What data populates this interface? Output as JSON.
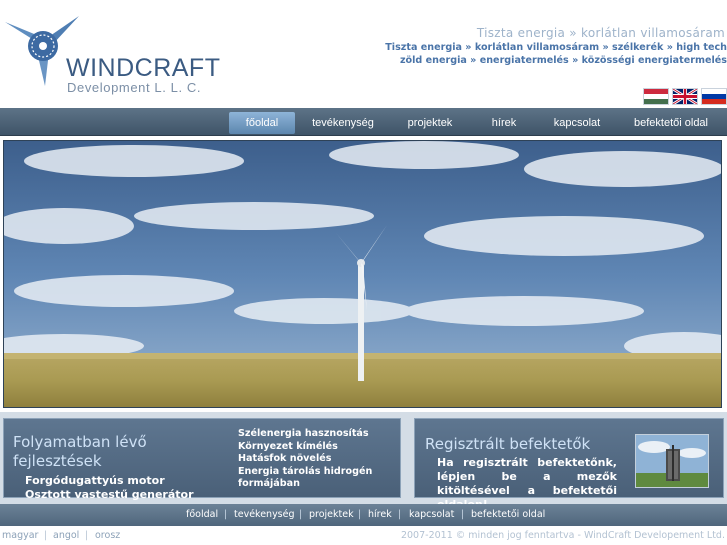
{
  "header": {
    "brand": "WINDCRAFT",
    "brand_sub": "Development L. L. C.",
    "slogan": "Tiszta energia » korlátlan villamosáram",
    "keywords_line1": "Tiszta energia » korlátlan villamosáram » szélkerék » high tech",
    "keywords_line2": "zöld energia » energiatermelés » közösségi energiatermelés",
    "flags": [
      "hungarian-flag",
      "british-flag",
      "russian-flag"
    ]
  },
  "nav": {
    "items": [
      {
        "label": "főoldal",
        "active": true
      },
      {
        "label": "tevékenység"
      },
      {
        "label": "projektek"
      },
      {
        "label": "hírek"
      },
      {
        "label": "kapcsolat"
      },
      {
        "label": "befektetői oldal"
      }
    ]
  },
  "panels": {
    "left": {
      "title": "Folyamatban lévő fejlesztések",
      "items": [
        "Forgódugattyús motor",
        "Osztott vastestű generátor"
      ],
      "list": [
        "Szélenergia hasznosítás",
        "Környezet kímélés",
        "Hatásfok növelés",
        "Energia tárolás hidrogén",
        "formájában"
      ]
    },
    "right": {
      "title": "Regisztrált befektetők",
      "text": "Ha regisztrált befektetőnk, lépjen be a mezők kitöltésével a befektetői oldalon!"
    }
  },
  "footer": {
    "nav": [
      "főoldal",
      "tevékenység",
      "projektek",
      "hírek",
      "kapcsolat",
      "befektetői oldal"
    ],
    "languages": [
      "magyar",
      "angol",
      "orosz"
    ],
    "copyright": "2007-2011 © minden jog fenntartva - WindCraft Developement Ltd."
  },
  "colors": {
    "brand_blue": "#3b5b82",
    "keyword_blue": "#4a74a8",
    "nav_bg": "#4a5f73",
    "panel_bg": "#566d85"
  }
}
